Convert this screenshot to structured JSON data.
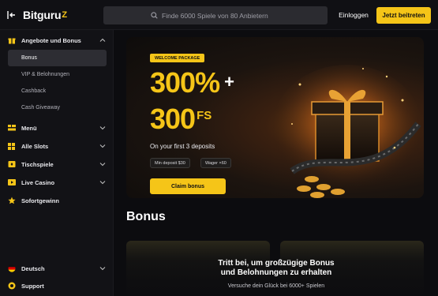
{
  "header": {
    "logo_main": "Bitguru",
    "logo_tail": "Z",
    "search_placeholder": "Finde 6000 Spiele von 80 Anbietern",
    "login_label": "Einloggen",
    "join_label": "Jetzt beitreten"
  },
  "sidebar": {
    "group_label": "Angebote und Bonus",
    "sub_items": [
      {
        "label": "Bonus",
        "active": true
      },
      {
        "label": "VIP & Belohnungen",
        "active": false
      },
      {
        "label": "Cashback",
        "active": false
      },
      {
        "label": "Cash Giveaway",
        "active": false
      }
    ],
    "items": [
      {
        "label": "Menü",
        "icon": "menu-icon"
      },
      {
        "label": "Alle Slots",
        "icon": "grid-icon"
      },
      {
        "label": "Tischspiele",
        "icon": "cards-icon"
      },
      {
        "label": "Live Casino",
        "icon": "live-icon"
      },
      {
        "label": "Sofortgewinn",
        "icon": "star-icon"
      }
    ],
    "language": "Deutsch",
    "support": "Support"
  },
  "hero": {
    "badge": "WELCOME PACKAGE",
    "line1": "300%",
    "plus": "+",
    "line2": "300",
    "fs": "FS",
    "subtitle": "On your first 3 deposits",
    "chip_min_deposit": "Min deposit $30",
    "chip_wager": "Wager ×60",
    "claim_label": "Claim bonus"
  },
  "section": {
    "title": "Bonus"
  },
  "overlay": {
    "title_line1": "Tritt bei, um großzügige Bonus",
    "title_line2": "und Belohnungen zu erhalten",
    "subtitle": "Versuche dein Glück bei 6000+ Spielen"
  },
  "colors": {
    "accent": "#f5c518",
    "background": "#0c0c0f",
    "sidebar": "#121216"
  }
}
